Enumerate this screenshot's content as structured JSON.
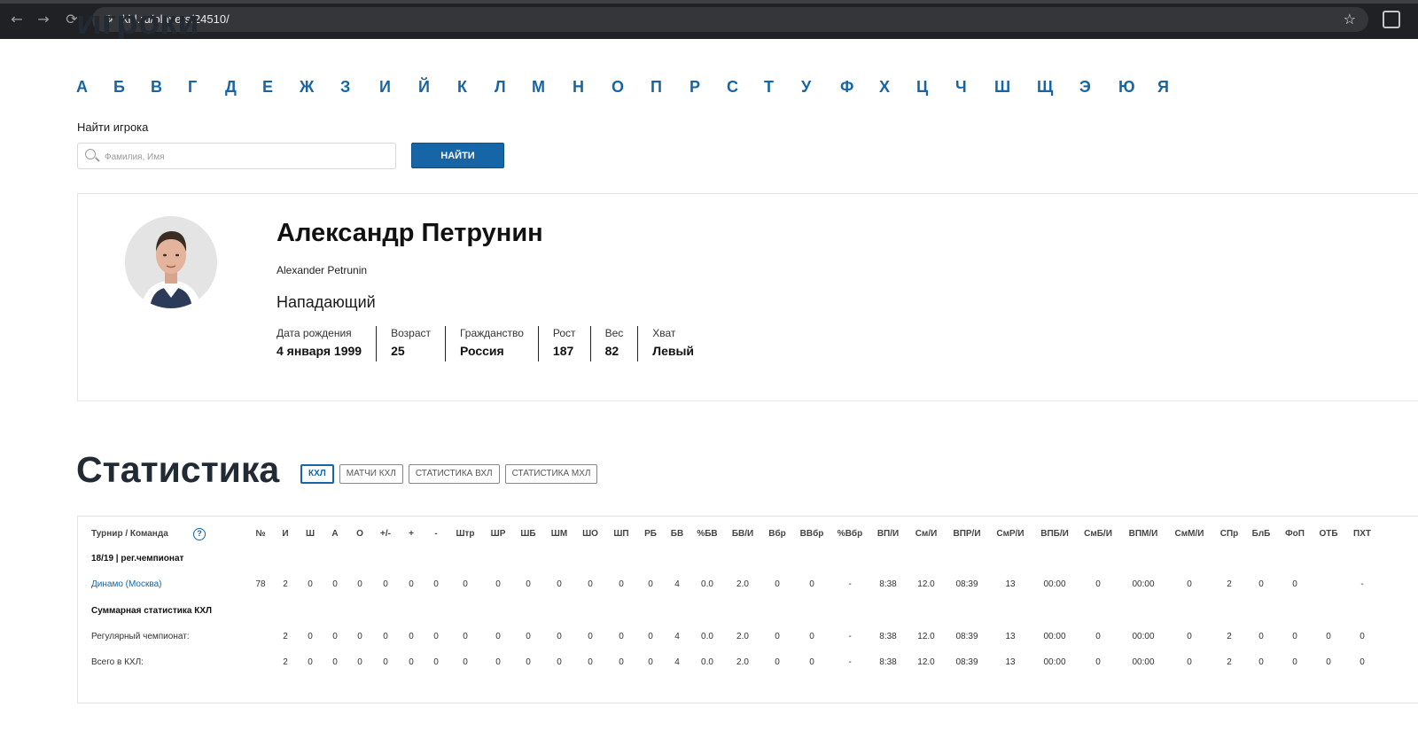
{
  "browser": {
    "url": "khl.ru/players/24510/",
    "back_icon": "←",
    "forward_icon": "→",
    "reload_icon": "⟳",
    "site_icon": "⚙",
    "star_icon": "☆"
  },
  "page": {
    "heading": "Игроки",
    "alphabet": [
      "А",
      "Б",
      "В",
      "Г",
      "Д",
      "Е",
      "Ж",
      "З",
      "И",
      "Й",
      "К",
      "Л",
      "М",
      "Н",
      "О",
      "П",
      "Р",
      "С",
      "Т",
      "У",
      "Ф",
      "Х",
      "Ц",
      "Ч",
      "Ш",
      "Щ",
      "Э",
      "Ю",
      "Я"
    ],
    "search": {
      "label": "Найти игрока",
      "placeholder": "Фамилия, Имя",
      "button": "НАЙТИ"
    }
  },
  "player": {
    "name_ru": "Александр Петрунин",
    "name_en": "Alexander Petrunin",
    "position": "Нападающий",
    "facts": [
      {
        "label": "Дата рождения",
        "value": "4 января 1999"
      },
      {
        "label": "Возраст",
        "value": "25"
      },
      {
        "label": "Гражданство",
        "value": "Россия"
      },
      {
        "label": "Рост",
        "value": "187"
      },
      {
        "label": "Вес",
        "value": "82"
      },
      {
        "label": "Хват",
        "value": "Левый"
      }
    ]
  },
  "stats": {
    "heading": "Статистика",
    "tabs": [
      "КХЛ",
      "МАТЧИ КХЛ",
      "СТАТИСТИКА ВХЛ",
      "СТАТИСТИКА МХЛ"
    ],
    "active_tab": "КХЛ",
    "first_col_header": "Турнир / Команда",
    "help_icon": "?",
    "columns": [
      "№",
      "И",
      "Ш",
      "А",
      "О",
      "+/-",
      "+",
      "-",
      "Штр",
      "ШР",
      "ШБ",
      "ШМ",
      "ШО",
      "ШП",
      "РБ",
      "БВ",
      "%БВ",
      "БВ/И",
      "Вбр",
      "ВВбр",
      "%Вбр",
      "ВП/И",
      "См/И",
      "ВПР/И",
      "СмР/И",
      "ВПБ/И",
      "СмБ/И",
      "ВПМ/И",
      "СмМ/И",
      "СПр",
      "БлБ",
      "ФоП",
      "ОТБ",
      "ПХТ"
    ],
    "season_label": "18/19 | рег.чемпионат",
    "team_row": {
      "team": "Динамо (Москва)",
      "values": [
        "78",
        "2",
        "0",
        "0",
        "0",
        "0",
        "0",
        "0",
        "0",
        "0",
        "0",
        "0",
        "0",
        "0",
        "0",
        "4",
        "0.0",
        "2.0",
        "0",
        "0",
        "-",
        "8:38",
        "12.0",
        "08:39",
        "13",
        "00:00",
        "0",
        "00:00",
        "0",
        "2",
        "0",
        "0",
        "",
        "-"
      ]
    },
    "summary_label": "Суммарная статистика КХЛ",
    "summary_rows": [
      {
        "label": "Регулярный чемпионат:",
        "values": [
          "",
          "2",
          "0",
          "0",
          "0",
          "0",
          "0",
          "0",
          "0",
          "0",
          "0",
          "0",
          "0",
          "0",
          "0",
          "4",
          "0.0",
          "2.0",
          "0",
          "0",
          "-",
          "8:38",
          "12.0",
          "08:39",
          "13",
          "00:00",
          "0",
          "00:00",
          "0",
          "2",
          "0",
          "0",
          "0",
          "0"
        ]
      },
      {
        "label": "Всего в КХЛ:",
        "values": [
          "",
          "2",
          "0",
          "0",
          "0",
          "0",
          "0",
          "0",
          "0",
          "0",
          "0",
          "0",
          "0",
          "0",
          "0",
          "4",
          "0.0",
          "2.0",
          "0",
          "0",
          "-",
          "8:38",
          "12.0",
          "08:39",
          "13",
          "00:00",
          "0",
          "00:00",
          "0",
          "2",
          "0",
          "0",
          "0",
          "0"
        ]
      }
    ]
  },
  "colors": {
    "accent": "#1565a7",
    "heading": "#222a33",
    "chrome": "#202124"
  }
}
